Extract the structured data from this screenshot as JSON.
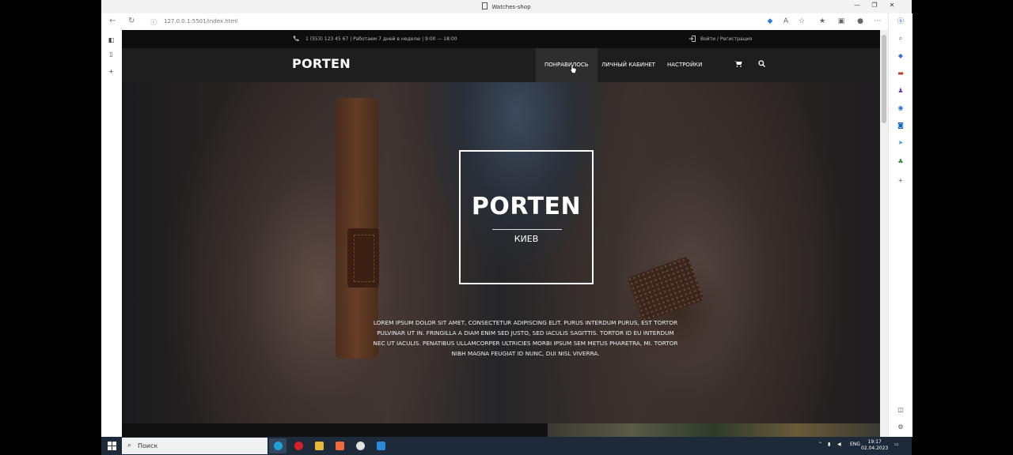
{
  "browser": {
    "window_title": "Watches-shop",
    "url": "127.0.0.1:5501/index.html"
  },
  "topbar": {
    "contact": "1 (553) 123 45 67 | Работаем 7 дней в неделю | 9:00 — 18:00",
    "auth": "Войти / Регистрация"
  },
  "navbar": {
    "logo": "PORTEN",
    "items": [
      "ПОНРАВИЛОСЬ",
      "ЛИЧНЫЙ КАБИНЕТ",
      "НАСТРОЙКИ"
    ]
  },
  "hero": {
    "title": "PORTEN",
    "subtitle": "КИЕВ",
    "text": "Lorem ipsum dolor sit amet, consectetur adipiscing elit. Purus interdum purus, est tortor pulvinar ut in. Fringilla a diam enim sed justo, sed iaculis sagittis. Tortor id eu interdum nec ut iaculis. Penatibus ullamcorper ultricies morbi ipsum sem metus pharetra, mi. Tortor nibh magna feugiat id nunc, dui nisl viverra."
  },
  "taskbar": {
    "search_placeholder": "Поиск",
    "lang": "ENG",
    "time": "19:17",
    "date": "02.04.2023"
  },
  "colors": {
    "page_bg": "#111111",
    "navbar_bg": "#1e1e1e",
    "active_nav_bg": "#2e2e2e",
    "taskbar_bg": "#1c2a3a"
  }
}
